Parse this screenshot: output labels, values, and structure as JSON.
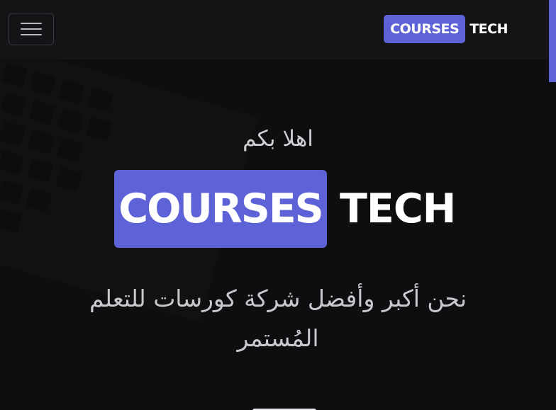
{
  "navbar": {
    "brand_highlight": "COURSES",
    "brand_rest": "TECH"
  },
  "hero": {
    "welcome": "اهلا بكم",
    "title_highlight": "COURSES",
    "title_rest": "TECH",
    "tagline": "نحن أكبر وأفضل شركة كورسات للتعلم المُستمر"
  },
  "colors": {
    "accent": "#5d62d6",
    "background": "#121214",
    "navbar": "#141416"
  },
  "icons": {
    "menu": "hamburger-menu-icon"
  }
}
